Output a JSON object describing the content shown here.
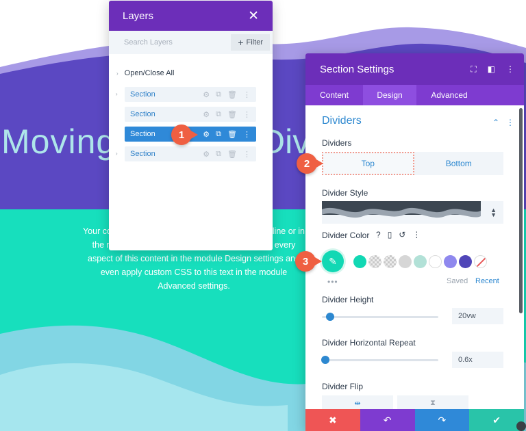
{
  "background": {
    "hero_title_left": "Moving",
    "hero_title_right": "Div",
    "body_text": "Your content goes here. Edit or remove this text inline or in the module Content settings. You can also style every aspect of this content in the module Design settings and even apply custom CSS to this text in the module Advanced settings.",
    "colors": {
      "purple": "#5b48c2",
      "teal": "#17dfbd",
      "light_teal": "#82d6e4"
    }
  },
  "layers_panel": {
    "title": "Layers",
    "close_label": "✕",
    "search_placeholder": "Search Layers",
    "filter_label": "Filter",
    "open_close_label": "Open/Close All",
    "rows": [
      {
        "label": "Section"
      },
      {
        "label": "Section"
      },
      {
        "label": "Section",
        "active": true
      },
      {
        "label": "Section"
      }
    ]
  },
  "settings_panel": {
    "title": "Section Settings",
    "tabs": [
      "Content",
      "Design",
      "Advanced"
    ],
    "active_tab": "Design",
    "section_title": "Dividers",
    "dividers_label": "Dividers",
    "dividers_options": [
      "Top",
      "Bottom"
    ],
    "divider_style_label": "Divider Style",
    "divider_color_label": "Divider Color",
    "color_help": "?",
    "swatches": [
      "#12d8b4",
      "checker",
      "checker",
      "#d6d6d6",
      "#b2e1d7",
      "#ffffff",
      "#8f88ee",
      "#5046b8",
      "none"
    ],
    "saved_label": "Saved",
    "recent_label": "Recent",
    "divider_height_label": "Divider Height",
    "divider_height_value": "20vw",
    "divider_height_fraction": 0.07,
    "divider_repeat_label": "Divider Horizontal Repeat",
    "divider_repeat_value": "0.6x",
    "divider_repeat_fraction": 0.03,
    "divider_flip_label": "Divider Flip"
  },
  "badges": [
    "1",
    "2",
    "3"
  ]
}
